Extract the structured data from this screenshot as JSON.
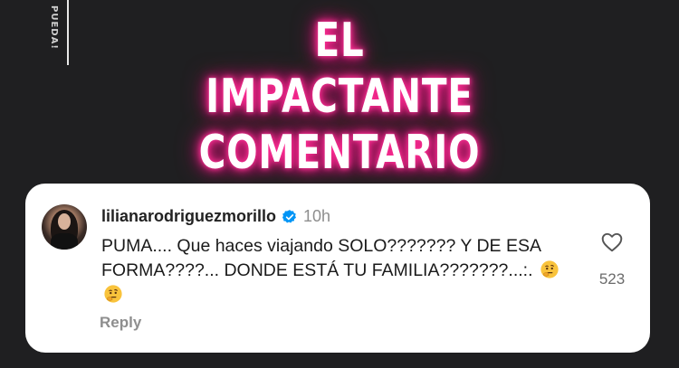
{
  "side_text": "PUEDA!",
  "headline": {
    "line1": "EL IMPACTANTE",
    "line2": "COMENTARIO"
  },
  "comment_card": {
    "username": "lilianarodriguezmorillo",
    "verified_icon": "verified-badge-icon",
    "time": "10h",
    "text": "PUMA.... Que haces viajando SOLO??????? Y DE ESA FORMA????... DONDE ESTÁ TU FAMILIA???????...:.",
    "emojis": [
      "thinking-face-emoji",
      "thinking-face-emoji"
    ],
    "reply_label": "Reply",
    "like_icon": "heart-icon",
    "like_count": "523"
  },
  "colors": {
    "background": "#1f1f21",
    "headline_glow": "#ff2e95",
    "verified_blue": "#0095f6"
  }
}
